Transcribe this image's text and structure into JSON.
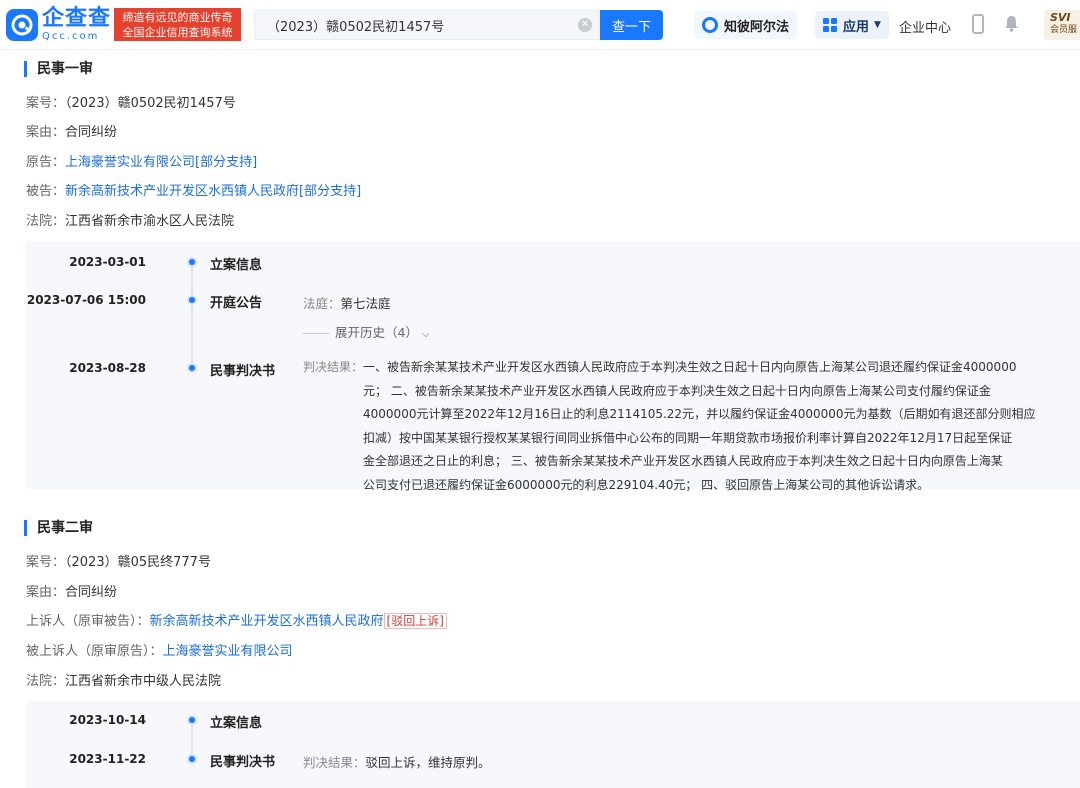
{
  "header": {
    "logo_cn": "企查查",
    "logo_en": "Qcc.com",
    "slogan_line1": "缔造有远见的商业传奇",
    "slogan_line2": "全国企业信用查询系统",
    "search_value": "（2023）赣0502民初1457号",
    "search_button": "查一下",
    "zhibi_label": "知彼阿尔法",
    "app_label": "应用",
    "enterprise_center": "企业中心",
    "svip_title": "SVI",
    "svip_sub": "会员服"
  },
  "first": {
    "title": "民事一审",
    "case_no_label": "案号：",
    "case_no": "（2023）赣0502民初1457号",
    "cause_label": "案由：",
    "cause": "合同纠纷",
    "plaintiff_label": "原告：",
    "plaintiff": "上海豪誉实业有限公司",
    "plaintiff_tag": "[部分支持]",
    "defendant_label": "被告：",
    "defendant": "新余高新技术产业开发区水西镇人民政府",
    "defendant_tag": "[部分支持]",
    "court_label": "法院：",
    "court": "江西省新余市渝水区人民法院",
    "timeline": [
      {
        "date": "2023-03-01",
        "type": "立案信息"
      },
      {
        "date": "2023-07-06 15:00",
        "type": "开庭公告",
        "detail_label": "法庭：",
        "detail": "第七法庭",
        "expand": "展开历史（4）"
      },
      {
        "date": "2023-08-28",
        "type": "民事判决书",
        "detail_label": "判决结果：",
        "lines": [
          "一、被告新余某某技术产业开发区水西镇人民政府应于本判决生效之日起十日内向原告上海某公司退还履约保证金4000000",
          "元；  二、被告新余某某技术产业开发区水西镇人民政府应于本判决生效之日起十日内向原告上海某公司支付履约保证金",
          "4000000元计算至2022年12月16日止的利息2114105.22元，并以履约保证金4000000元为基数（后期如有退还部分则相应",
          "扣减）按中国某某银行授权某某银行间同业拆借中心公布的同期一年期贷款市场报价利率计算自2022年12月17日起至保证",
          "金全部退还之日止的利息；  三、被告新余某某技术产业开发区水西镇人民政府应于本判决生效之日起十日内向原告上海某",
          "公司支付已退还履约保证金6000000元的利息229104.40元；  四、驳回原告上海某公司的其他诉讼请求。"
        ]
      }
    ]
  },
  "second": {
    "title": "民事二审",
    "case_no_label": "案号：",
    "case_no": "（2023）赣05民终777号",
    "cause_label": "案由：",
    "cause": "合同纠纷",
    "appellant_label": "上诉人（原审被告）：",
    "appellant": "新余高新技术产业开发区水西镇人民政府",
    "appellant_tag": "[驳回上诉]",
    "appellee_label": "被上诉人（原审原告）：",
    "appellee": "上海豪誉实业有限公司",
    "court_label": "法院：",
    "court": "江西省新余市中级人民法院",
    "timeline": [
      {
        "date": "2023-10-14",
        "type": "立案信息"
      },
      {
        "date": "2023-11-22",
        "type": "民事判决书",
        "detail_label": "判决结果：",
        "detail": "驳回上诉，维持原判。"
      }
    ]
  },
  "colors": {
    "brand": "#1a78ff",
    "link": "#1a6edb",
    "slogan_bg": "#e5412e",
    "reject_tag": "#d9383a"
  }
}
